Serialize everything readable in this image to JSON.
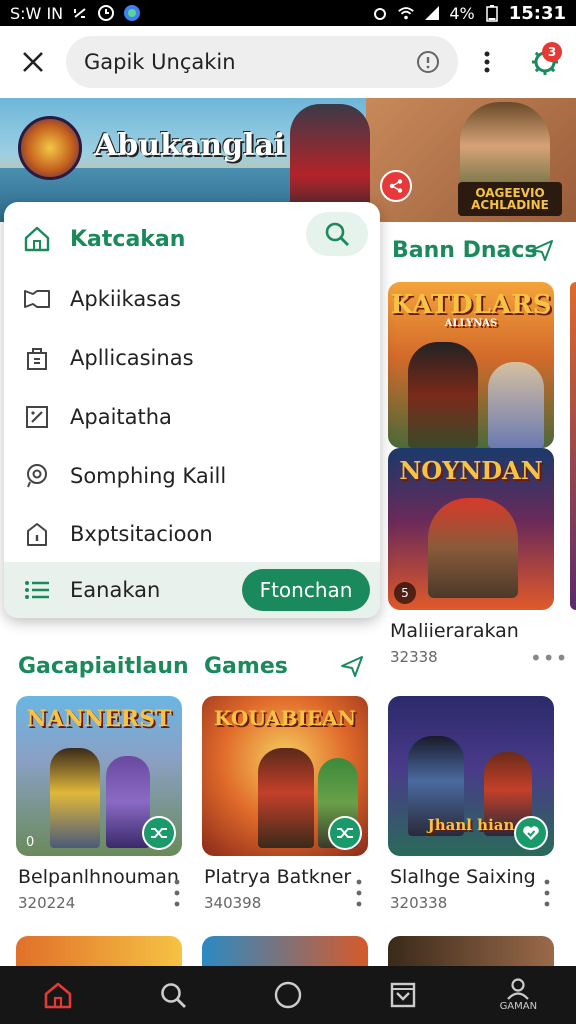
{
  "status_bar": {
    "left_text": "S:W IN",
    "battery": "4%",
    "time": "15:31"
  },
  "top_bar": {
    "search_text": "Gapik Unçakin",
    "notification_count": "3"
  },
  "banner": {
    "brand": "Abukanglai",
    "sub_line1": "OAGEEVIO",
    "sub_line2": "ACHLADINE"
  },
  "menu": {
    "items": [
      {
        "label": "Katcakan",
        "icon": "home-icon"
      },
      {
        "label": "Apkiikasas",
        "icon": "bookmark-icon"
      },
      {
        "label": "Apllicasinas",
        "icon": "bag-icon"
      },
      {
        "label": "Apaitatha",
        "icon": "edit-box-icon"
      },
      {
        "label": "Somphing Kaill",
        "icon": "location-pin-icon"
      },
      {
        "label": "Bxptsitacioon",
        "icon": "lock-icon"
      }
    ],
    "footer_label": "Eanakan",
    "footer_button": "Ftonchan"
  },
  "right_section": {
    "title": "Bann Dnacs",
    "tile_a_art": "KATDLARS",
    "tile_a_art_sub": "ALLYNAS",
    "tile_b_art": "NOYNDAN",
    "tile_b_badge": "5",
    "game_title": "Maliierarakan",
    "game_count": "32338"
  },
  "lower_section": {
    "title_left": "Gacapiaitlaun",
    "title_right": "Games",
    "cards": [
      {
        "art": "NANNERST",
        "title": "Belpanlhnouman",
        "count": "320224",
        "corner": "0"
      },
      {
        "art": "KOUABIEAN",
        "title": "Platrya Batkner",
        "count": "340398"
      },
      {
        "art": "Jhanl hian",
        "title": "Slalhge Saixing",
        "count": "320338"
      }
    ]
  },
  "bottom_nav": {
    "profile_label": "GAMAN"
  },
  "colors": {
    "accent": "#1a8a5c",
    "badge": "#e53935"
  }
}
